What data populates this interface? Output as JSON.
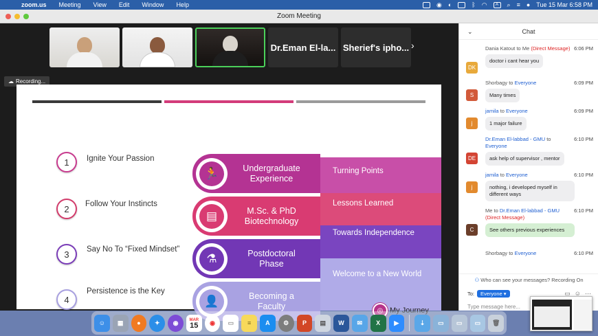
{
  "menubar": {
    "apple": "",
    "app": "zoom.us",
    "items": [
      "Meeting",
      "View",
      "Edit",
      "Window",
      "Help"
    ],
    "datetime": "Tue 15 Mar  6:58 PM"
  },
  "window": {
    "title": "Zoom Meeting"
  },
  "gallery": {
    "names": [
      "Dr.Eman El-la...",
      "Sherief's ipho..."
    ],
    "next": "›"
  },
  "recording": {
    "label": "Recording..."
  },
  "slide": {
    "steps": [
      {
        "num": "1",
        "text": "Ignite Your Passion"
      },
      {
        "num": "2",
        "text": "Follow Your Instincts"
      },
      {
        "num": "3",
        "text": "Say No To “Fixed Mindset”"
      },
      {
        "num": "4",
        "text": "Persistence is the Key"
      }
    ],
    "stages": [
      {
        "line1": "Undergraduate",
        "line2": "Experience",
        "right": "Turning Points"
      },
      {
        "line1": "M.Sc. & PhD",
        "line2": "Biotechnology",
        "right": "Lessons Learned"
      },
      {
        "line1": "Postdoctoral",
        "line2": "Phase",
        "right": "Towards Independence"
      },
      {
        "line1": "Becoming a",
        "line2": "Faculty",
        "right": "Welcome to a New World"
      }
    ],
    "journey": "My Journey",
    "colors": {
      "magenta": "#b43393",
      "pink": "#d93b72",
      "purple": "#7237b5",
      "lavender": "#a9a2e2"
    }
  },
  "chat": {
    "title": "Chat",
    "messages": [
      {
        "initials": "DK",
        "from": "Dania Katout",
        "to_word": "to",
        "to": "Me",
        "dm": "(Direct Message)",
        "time": "6:06 PM",
        "text": "doctor i cant hear you",
        "color": "#e8a93b"
      },
      {
        "initials": "S",
        "from": "Shorbagy",
        "to_word": "to",
        "to": "Everyone",
        "dm": "",
        "time": "6:09 PM",
        "text": "Many times",
        "color": "#d25a3a"
      },
      {
        "initials": "j",
        "from": "jamila",
        "to_word": "to",
        "to": "Everyone",
        "dm": "",
        "time": "6:09 PM",
        "text": "1 major failure",
        "color": "#e28a2e"
      },
      {
        "initials": "DE",
        "from": "Dr.Eman El-labbad - GMU",
        "to_word": "to",
        "to": "Everyone",
        "dm": "",
        "time": "6:10 PM",
        "text": "ask help of supervisor , mentor",
        "color": "#d34433"
      },
      {
        "initials": "j",
        "from": "jamila",
        "to_word": "to",
        "to": "Everyone",
        "dm": "",
        "time": "6:10 PM",
        "text": "nothing, i developed myself in different ways",
        "color": "#e28a2e"
      },
      {
        "initials": "C",
        "from": "Me",
        "to_word": "to",
        "to": "Dr.Eman El-labbad - GMU",
        "dm": "(Direct Message)",
        "time": "6:10 PM",
        "text": "See others previous experiences",
        "color": "#6b3e2a"
      },
      {
        "initials": "",
        "from": "Shorbagy",
        "to_word": "to",
        "to": "Everyone",
        "dm": "",
        "time": "6:10 PM",
        "text": "",
        "color": "#d25a3a"
      }
    ],
    "who_can_see": "Who can see your messages? Recording On",
    "to_label": "To:",
    "to_value": "Everyone ▾",
    "input_placeholder": "Type message here..."
  },
  "dock": {
    "calendar_month": "MAR",
    "calendar_day": "15"
  }
}
